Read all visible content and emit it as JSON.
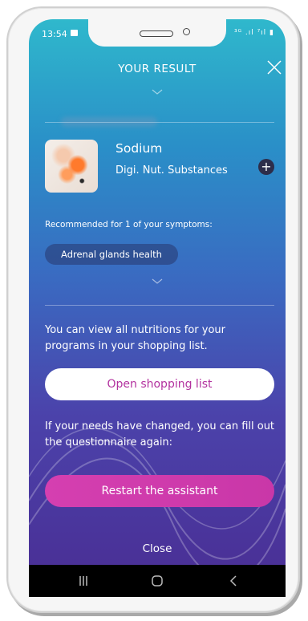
{
  "status_bar": {
    "time": "13:54",
    "right_icons_text": "³ᴳ .ıl ⁷ıl ▮"
  },
  "header": {
    "title": "YOUR RESULT"
  },
  "product": {
    "name": "Sodium",
    "category": "Digi. Nut. Substances",
    "add_icon": "plus-circle-icon"
  },
  "recommendation": {
    "text": "Recommended for 1 of your symptoms:",
    "symptoms": [
      "Adrenal glands health"
    ]
  },
  "shopping_info": {
    "text": "You can view all nutritions for your programs in your shopping list.",
    "button_label": "Open shopping list"
  },
  "questionnaire_info": {
    "text": "If your needs have changed, you can fill out the questionnaire again:",
    "button_label": "Restart the assistant"
  },
  "footer": {
    "close_label": "Close"
  },
  "colors": {
    "accent_pink": "#c937a8",
    "button_text_pink": "#b3329f",
    "gradient_top": "#2fb8cc",
    "gradient_bottom": "#4a2d93"
  }
}
